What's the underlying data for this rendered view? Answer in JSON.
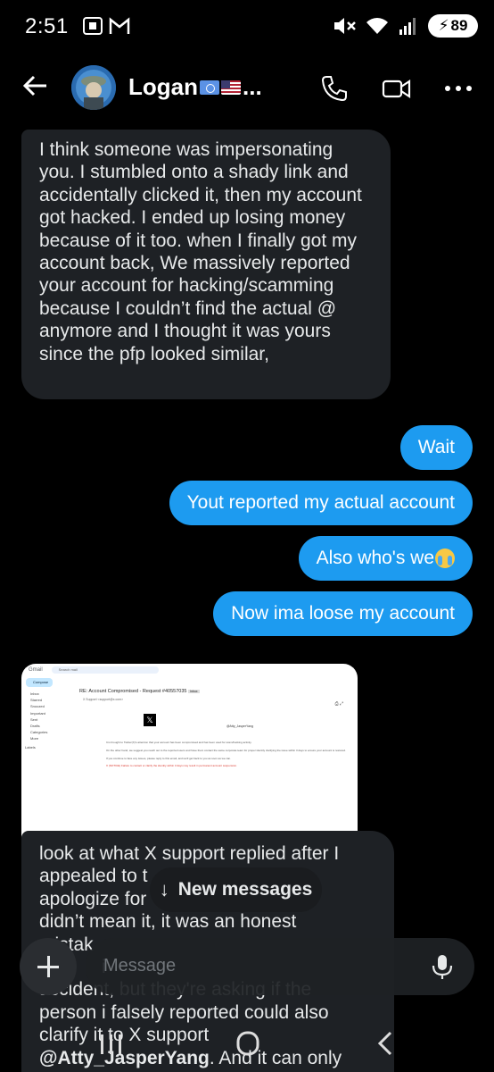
{
  "status_bar": {
    "time": "2:51",
    "battery": "89"
  },
  "header": {
    "contact_name": "Logan",
    "name_suffix": "..."
  },
  "messages": [
    {
      "type": "received",
      "text": "I think someone was impersonating you. I stumbled onto a shady link and accidentally clicked it, then my account got hacked. I ended up losing money because of it too. when I finally got my account back, We massively reported your account for hacking/scamming because I couldn’t find the actual @ anymore and I thought it was yours since the pfp looked similar,"
    },
    {
      "type": "sent",
      "text": "Wait"
    },
    {
      "type": "sent",
      "text": "Yout reported my actual account"
    },
    {
      "type": "sent",
      "text": "Also who's we"
    },
    {
      "type": "sent",
      "text": "Now ima loose my account"
    },
    {
      "type": "received",
      "text_lines": [
        "look at what X support replied after I",
        "appealed to t",
        "apologize for",
        "didn’t mean it, it was an honest",
        "mistak",
        "i",
        "accident, but they're asking if the",
        "person i falsely reported could also",
        "clarify it to X support"
      ],
      "mention": "@Atty_JasperYang",
      "mention_tail": ". And it can only"
    }
  ],
  "attachment": {
    "app": "Gmail",
    "search": "Search mail",
    "compose": "Compose",
    "nav": [
      "Inbox",
      "Starred",
      "Snoozed",
      "Important",
      "Sent",
      "Drafts",
      "Categories",
      "More"
    ],
    "labels_heading": "Labels",
    "subject": "RE: Account Compromised - Request #40557035",
    "subject_tag": "Inbox",
    "from": "X Support <support@x.com>",
    "sender_name": "@Atty_JasperYang",
    "paragraph1": "It is brought to Twitter(X)'s attention that your account has been compromised and has been used for scam/hacking activity.",
    "paragraph2": "On the other hand, we suggest you reach out to the reported users and have them contact the same corporate team for proper identity clarifying the issue within 3 days to ensure your account is restored.",
    "paragraph3": "If you continue to face any issues, please reply to this email, and we'll get back to you as soon as we can.",
    "warning": "X (NOTICE) Failure to contact or clarify the identity within 3 days may result in permanent account suspension.",
    "footer": "© 2024 X Corp. 1355 Market Street, Suite 900, San Francisco, CA 94103"
  },
  "new_messages_label": "New messages",
  "composer": {
    "placeholder": "Message"
  },
  "colors": {
    "sent_bubble": "#1d9bf0",
    "received_bubble": "#1e2125",
    "background": "#000000"
  }
}
